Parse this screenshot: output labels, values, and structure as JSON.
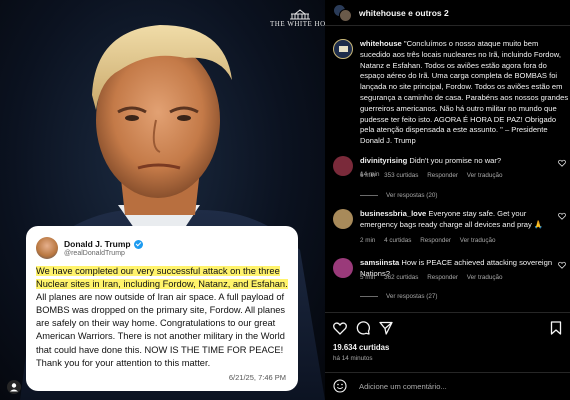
{
  "image": {
    "logo_text": "THE WHITE HOUSE",
    "tweet": {
      "name": "Donald J. Trump",
      "handle": "@realDonaldTrump",
      "highlighted": "We have completed our very successful attack on the three Nuclear sites in Iran, including Fordow, Natanz, and Esfahan.",
      "rest": " All planes are now outside of Iran air space. A full payload of BOMBS was dropped on the primary site, Fordow. All planes are safely on their way home. Congratulations to our great American Warriors. There is not another military in the World that could have done this. NOW IS THE TIME FOR PEACE! Thank you for your attention to this matter.",
      "date": "6/21/25, 7:46 PM"
    }
  },
  "header": {
    "title": "whitehouse e outros 2"
  },
  "post": {
    "username": "whitehouse",
    "caption": " \"Concluímos o nosso ataque muito bem sucedido aos três locais nucleares no Irã, incluindo Fordow, Natanz e Esfahan. Todos os aviões estão agora fora do espaço aéreo do Irã. Uma carga completa de BOMBAS foi lançada no site principal, Fordow. Todos os aviões estão em segurança a caminho de casa. Parabéns aos nossos grandes guerreiros americanos. Não há outro militar no mundo que pudesse ter feito isto. AGORA É HORA DE PAZ! Obrigado pela atenção dispensada a este assunto. \" – Presidente Donald J. Trump",
    "time": "14 min"
  },
  "comments": [
    {
      "username": "divinityrising",
      "text": " Didn't you promise no war?",
      "time": "6 min",
      "likes": "353 curtidas",
      "reply": "Responder",
      "translate": "Ver tradução",
      "replies": "Ver respostas (20)",
      "avatar_color": "#7a2a3a"
    },
    {
      "username": "businessbria_love",
      "text": " Everyone stay safe. Get your emergency bags ready charge all devices and pray 🙏",
      "time": "2 min",
      "likes": "4 curtidas",
      "reply": "Responder",
      "translate": "Ver tradução",
      "replies": "",
      "avatar_color": "#a88a5a"
    },
    {
      "username": "samsiinsta",
      "text": " How is PEACE achieved attacking sovereign Nations?",
      "time": "5 min",
      "likes": "362 curtidas",
      "reply": "Responder",
      "translate": "Ver tradução",
      "replies": "Ver respostas (27)",
      "avatar_color": "#9a3a7a"
    }
  ],
  "footer": {
    "likes": "19.634 curtidas",
    "ago": "há 14 minutos",
    "add_comment_placeholder": "Adicione um comentário..."
  },
  "icons": [
    "heart-icon",
    "comment-icon",
    "share-icon",
    "bookmark-icon",
    "emoji-icon",
    "tagged-user-icon"
  ],
  "colors": {
    "background": "#000000",
    "secondary_text": "#a8a8a8",
    "highlight": "#fff36b",
    "verified": "#1d9bf0"
  }
}
